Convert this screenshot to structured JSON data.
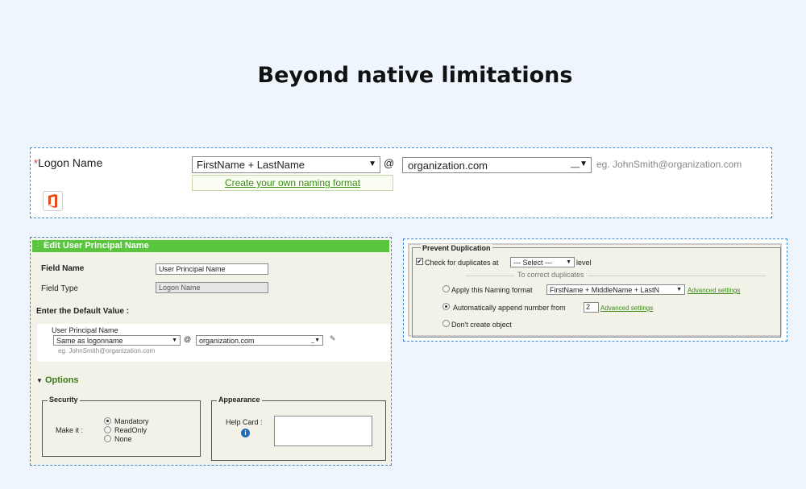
{
  "title": "Beyond native limitations",
  "logon": {
    "required_mark": "*",
    "label": "Logon Name",
    "format_value": "FirstName + LastName",
    "at": "@",
    "domain_value": "organization.com",
    "example": "eg.  JohnSmith@organization.com",
    "create_link": "Create your own naming format",
    "office_icon": "office-icon"
  },
  "upn": {
    "header": "Edit User Principal Name",
    "field_name_label": "Field Name",
    "field_name_value": "User Principal Name",
    "field_type_label": "Field Type",
    "field_type_value": "Logon Name",
    "default_value_label": "Enter the Default Value :",
    "upn_label": "User Principal Name",
    "format_value": "Same as logonname",
    "at": "@",
    "domain_value": "organization.com",
    "example": "eg. JohnSmith@organization.com",
    "options_label": "Options",
    "security": {
      "legend": "Security",
      "make_it_label": "Make it :",
      "options": [
        "Mandatory",
        "ReadOnly",
        "None"
      ],
      "selected": "Mandatory"
    },
    "appearance": {
      "legend": "Appearance",
      "help_card_label": "Help Card :",
      "help_text": ""
    }
  },
  "prevent": {
    "legend": "Prevent Duplication",
    "check_label": "Check for duplicates at",
    "check_checked": true,
    "level_select": "--- Select ---",
    "level_label": "level",
    "correct_heading": "To correct duplicates",
    "apply_label": "Apply this Naming format",
    "apply_select": "FirstName + MiddleName + LastN",
    "advanced_label": "Advanced settings",
    "append_label": "Automatically append number from",
    "append_value": "2",
    "dont_create_label": "Don't create object",
    "selected": "append"
  },
  "colors": {
    "accent_green": "#5ac63e",
    "link_green": "#3b8a17",
    "dashed_blue": "#3a8ad6",
    "office_red": "#e64a19"
  }
}
